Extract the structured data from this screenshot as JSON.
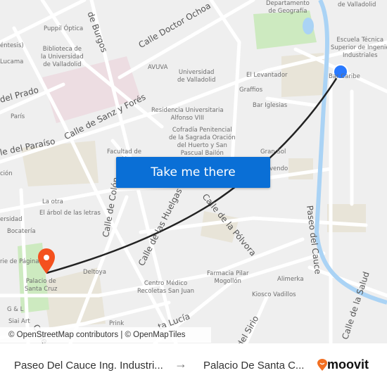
{
  "map": {
    "streets": [
      "de Burgos",
      "Calle Doctor Ochoa",
      "del Prado",
      "Calle de Sanz y Forés",
      "le del Paraíso",
      "Calle de Colón",
      "Calle de las Huelgas",
      "Calle de la Pólvora",
      "Paseo del Cauce",
      "Calle de la Salud",
      "del Sirio",
      "ta Lucía",
      "Calle"
    ],
    "pois": [
      "Puppil Óptica",
      "éntesis)",
      "Biblioteca de\nla Universidad\nde Valladolid",
      "Lucama",
      "París",
      "AVUVA",
      "Universidad\nde Valladolid",
      "Residencia Universitaria\nAlfonso VIII",
      "Cofradía Penitencial\nde la Sagrada Oración\ndel Huerto y San\nPascual Bailón",
      "Facultad de\nM",
      "Departamento\nde Geografía",
      "de Valladolid",
      "Escuela Técnica\nSuperior de Ingenie\nIndustriales",
      "El Levantador",
      "Graffios",
      "Bar Iglesias",
      "Gran Sol",
      "Bar Caribe",
      "ción",
      "La otra",
      "El árbol de las letras",
      "ersidad",
      "Bocatería",
      "rie de Página",
      "Palacio de\nSanta Cruz",
      "Deltoya",
      "G & L",
      "Centro Médico\nRecoletas San Juan",
      "Farmacia Pilar\nMogollón",
      "Alimerka",
      "Kiosco Vadillos",
      "Prink",
      "Siai Art",
      "vendo"
    ],
    "origin_marker_color": "#2979ff",
    "destination_marker_color": "#f4511e",
    "route_color": "#222222",
    "river_color": "#aad3f5",
    "park_color": "#cdeac0"
  },
  "cta": {
    "label": "Take me there",
    "color": "#0a6fd6"
  },
  "attribution": "© OpenStreetMap contributors | © OpenMapTiles",
  "footer": {
    "from": "Paseo Del Cauce Ing. Industri...",
    "arrow": "→",
    "to": "Palacio De Santa C...",
    "brand": "moovit",
    "brand_color": "#f26f22"
  }
}
